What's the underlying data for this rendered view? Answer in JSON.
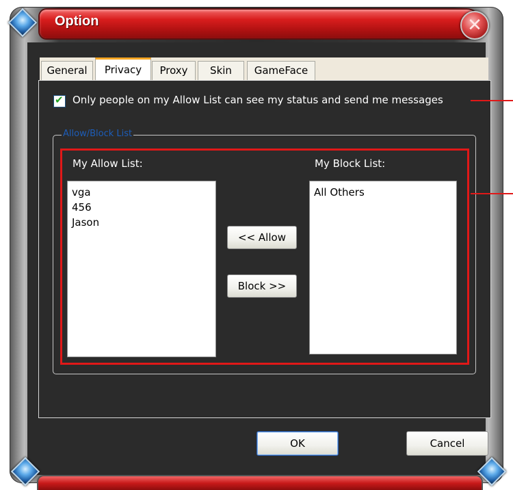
{
  "window": {
    "title": "Option"
  },
  "tabs": [
    {
      "label": "General",
      "active": false
    },
    {
      "label": "Privacy",
      "active": true
    },
    {
      "label": "Proxy",
      "active": false
    },
    {
      "label": "Skin",
      "active": false
    },
    {
      "label": "GameFace",
      "active": false
    }
  ],
  "privacy": {
    "only_allow_list": {
      "checked": true,
      "label": "Only people on my Allow List can see my status and send me messages"
    },
    "group_title": "Allow/Block List",
    "allow_list": {
      "label": "My Allow List:",
      "items": [
        "vga",
        "456",
        "Jason"
      ]
    },
    "block_list": {
      "label": "My Block List:",
      "items": [
        "All Others"
      ]
    },
    "allow_button": "<< Allow",
    "block_button": "Block >>"
  },
  "footer": {
    "ok_label": "OK",
    "cancel_label": "Cancel"
  },
  "colors": {
    "title_bar": "#d81d1d",
    "highlight_box": "#e01818",
    "background": "#2b2b2b",
    "group_title": "#1d5db8"
  },
  "icons": {
    "close": "close-icon",
    "check": "checkmark-icon",
    "corners": "diamond-gem-icon"
  }
}
